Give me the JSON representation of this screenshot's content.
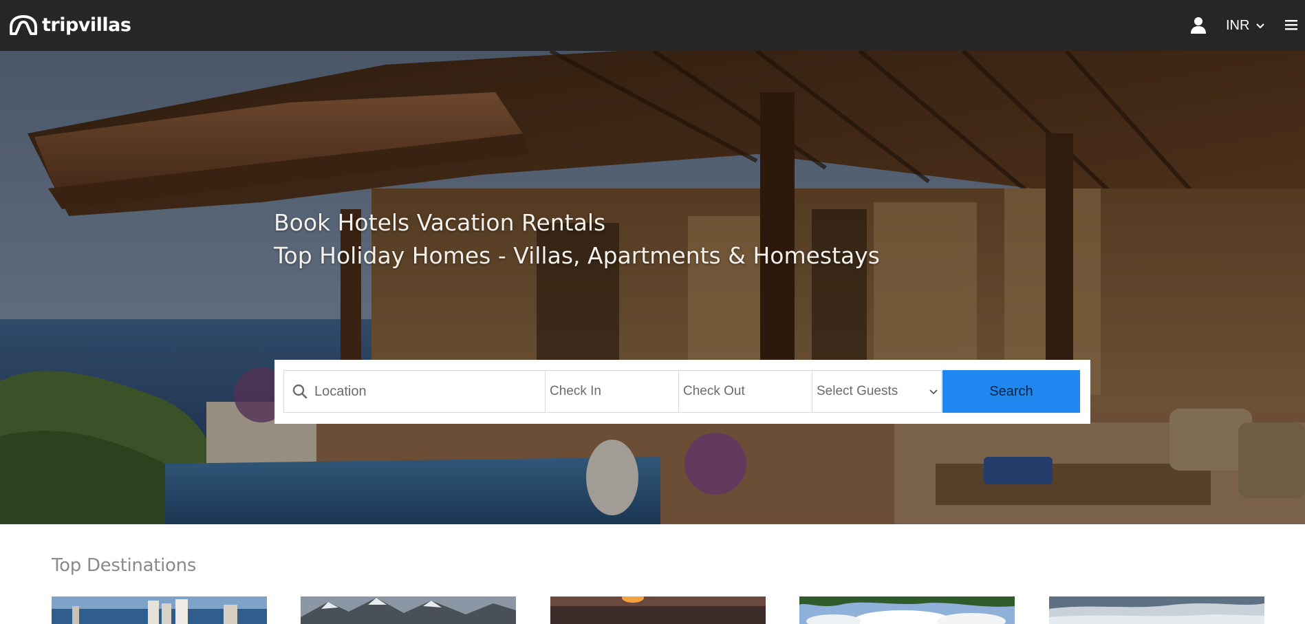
{
  "navbar": {
    "brand": "tripvillas",
    "currency": "INR",
    "icons": [
      "logo-icon",
      "user-icon",
      "chevron-down-icon",
      "menu-icon"
    ]
  },
  "hero": {
    "title_line1": "Book Hotels Vacation Rentals",
    "title_line2": "Top Holiday Homes - Villas, Apartments & Homestays"
  },
  "search": {
    "location_placeholder": "Location",
    "checkin_placeholder": "Check In",
    "checkout_placeholder": "Check Out",
    "guests_selected": "Select Guests",
    "button_label": "Search",
    "button_color": "#1e88f0"
  },
  "destinations": {
    "title": "Top Destinations",
    "cards": [
      {
        "image": "coastal-city-skyline"
      },
      {
        "image": "snowy-mountains"
      },
      {
        "image": "sunset-sky"
      },
      {
        "image": "trees-and-clouds"
      },
      {
        "image": "hazy-hills"
      }
    ]
  },
  "colors": {
    "navbar": "#262626",
    "accent": "#1e88f0",
    "section_title": "#8a8a8a"
  }
}
